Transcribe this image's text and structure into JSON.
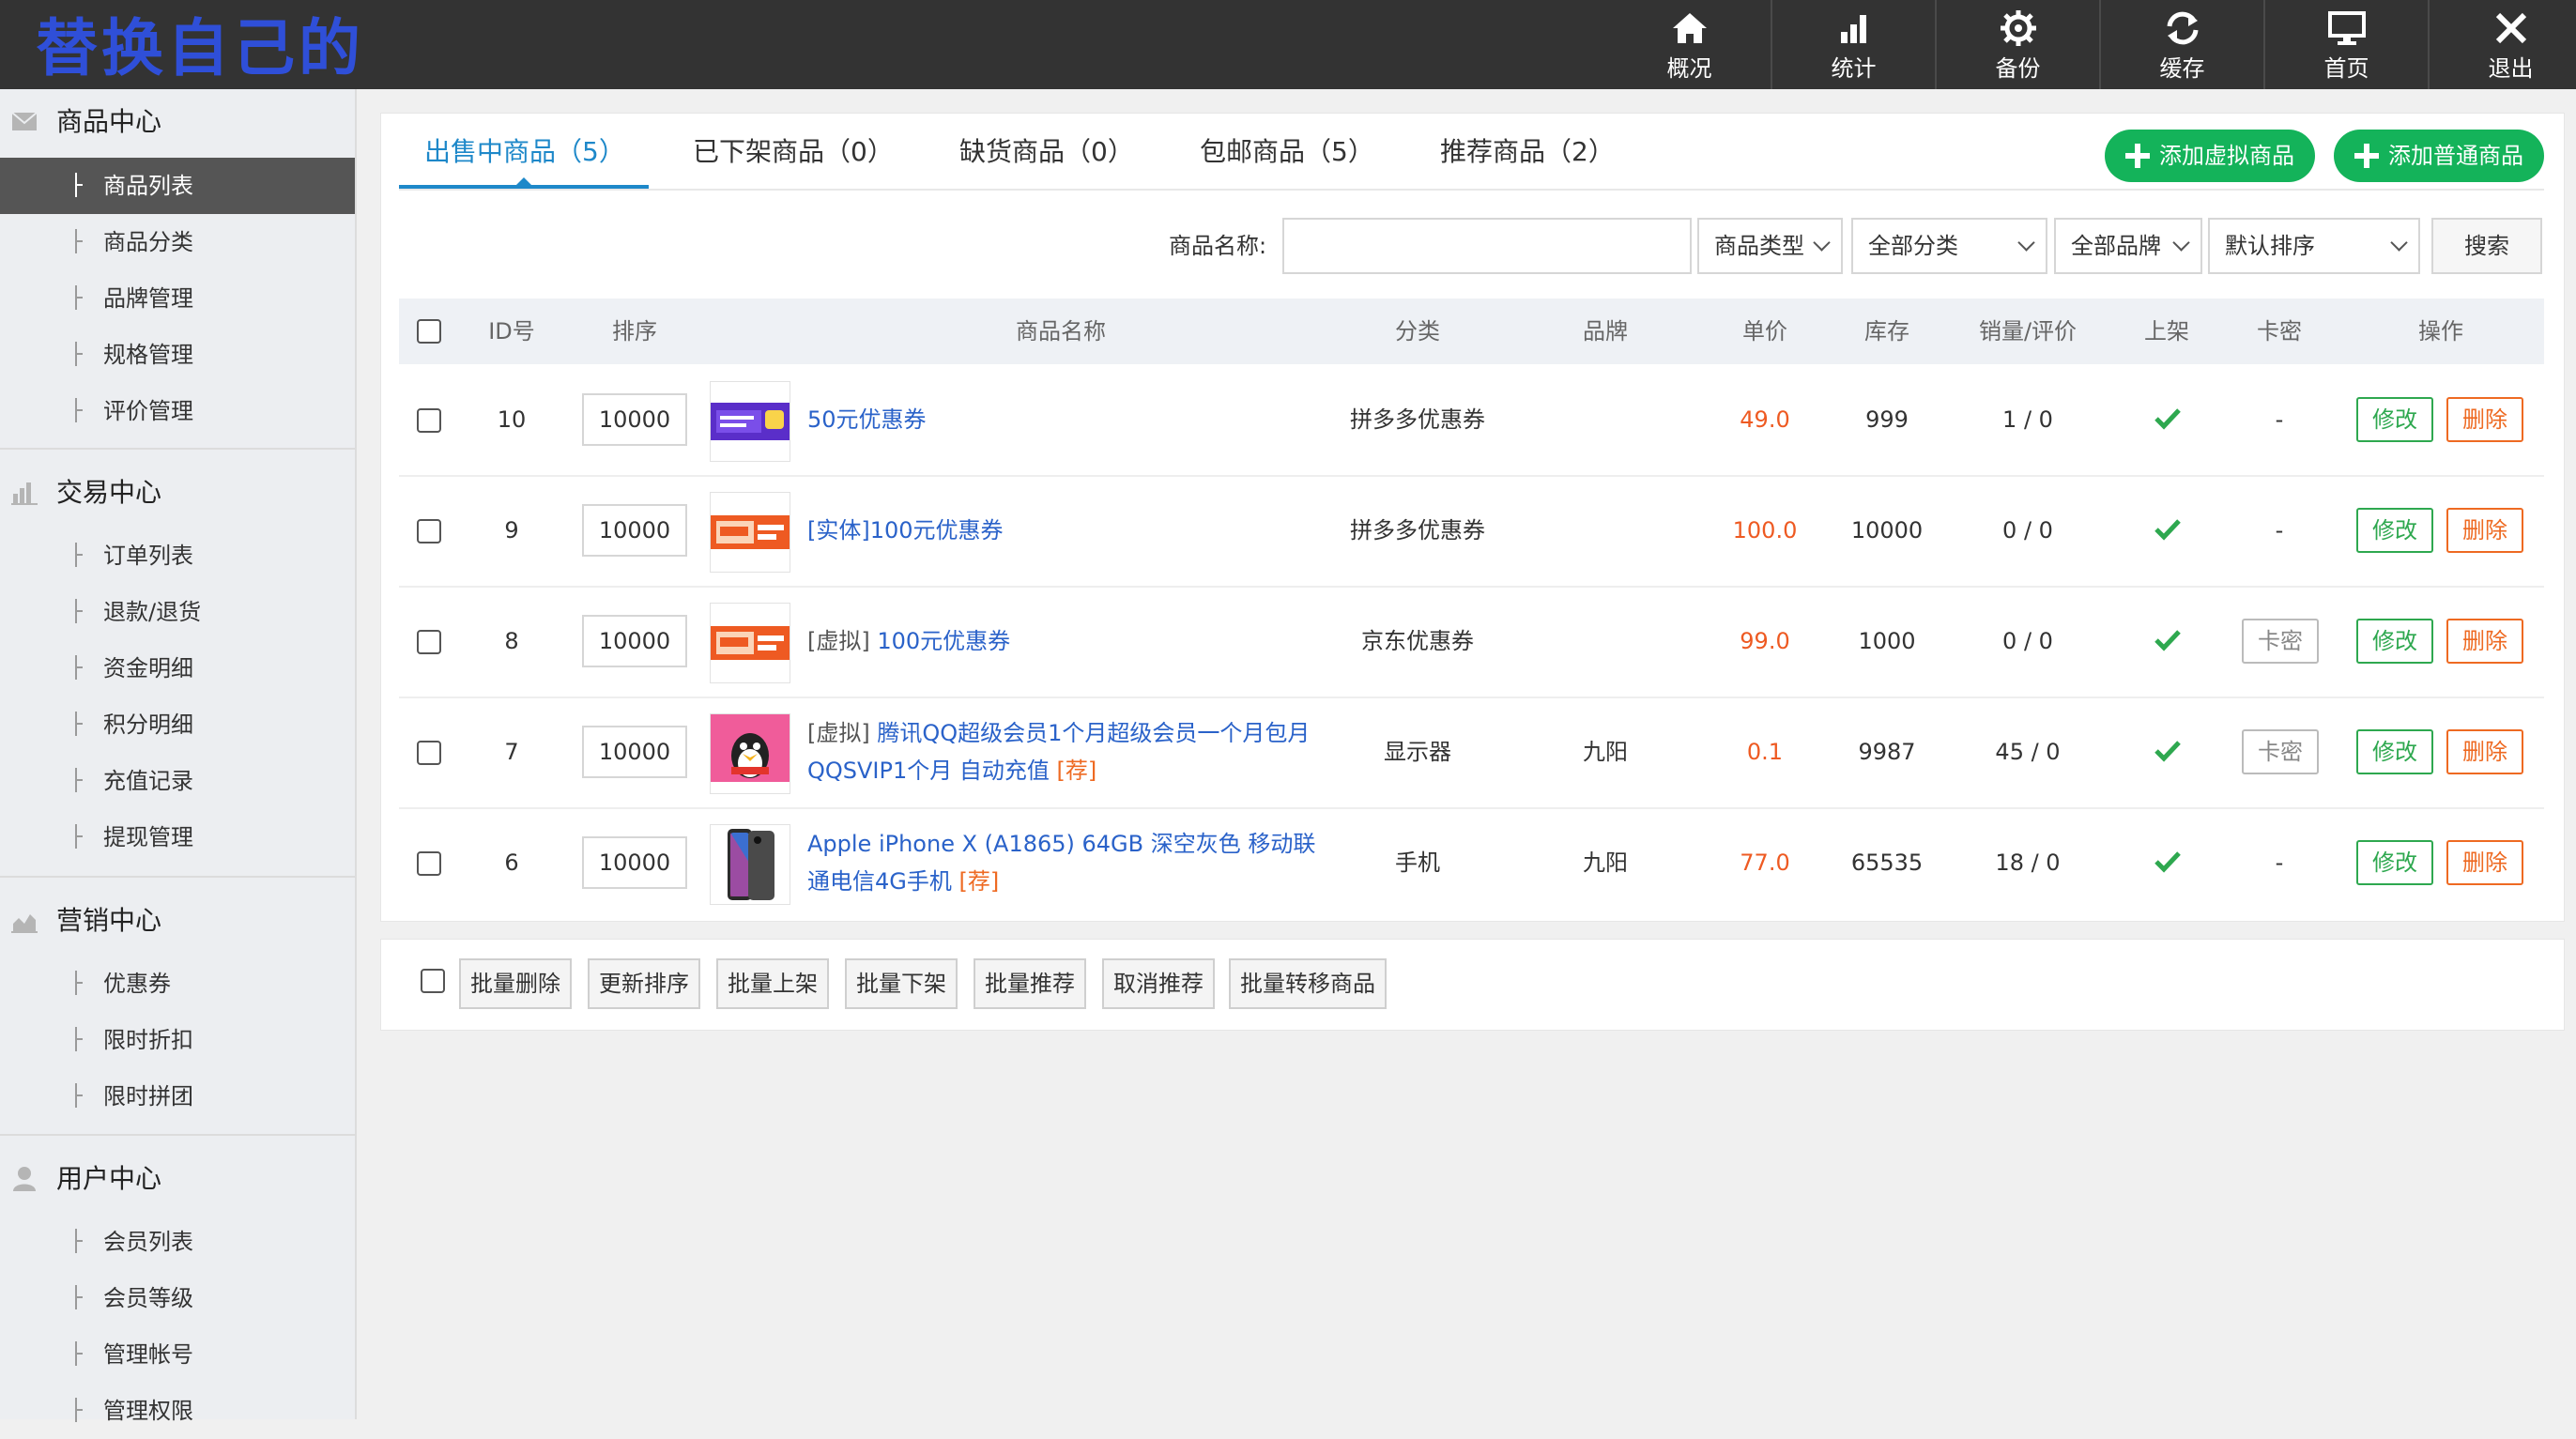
{
  "brand": "替换自己的",
  "topnav": [
    {
      "label": "概况",
      "icon": "home-icon"
    },
    {
      "label": "统计",
      "icon": "bar-chart-icon"
    },
    {
      "label": "备份",
      "icon": "gear-icon"
    },
    {
      "label": "缓存",
      "icon": "refresh-icon"
    },
    {
      "label": "首页",
      "icon": "monitor-icon"
    },
    {
      "label": "退出",
      "icon": "close-icon"
    }
  ],
  "sidebar": {
    "sections": [
      {
        "title": "商品中心",
        "icon": "mail-icon",
        "items": [
          "商品列表",
          "商品分类",
          "品牌管理",
          "规格管理",
          "评价管理"
        ]
      },
      {
        "title": "交易中心",
        "icon": "bar-chart-icon",
        "items": [
          "订单列表",
          "退款/退货",
          "资金明细",
          "积分明细",
          "充值记录",
          "提现管理"
        ]
      },
      {
        "title": "营销中心",
        "icon": "area-chart-icon",
        "items": [
          "优惠券",
          "限时折扣",
          "限时拼团"
        ]
      },
      {
        "title": "用户中心",
        "icon": "user-icon",
        "items": [
          "会员列表",
          "会员等级",
          "管理帐号",
          "管理权限"
        ]
      }
    ],
    "active_item": "商品列表"
  },
  "tabs": [
    {
      "label": "出售中商品（5）",
      "active": true
    },
    {
      "label": "已下架商品（0）",
      "active": false
    },
    {
      "label": "缺货商品（0）",
      "active": false
    },
    {
      "label": "包邮商品（5）",
      "active": false
    },
    {
      "label": "推荐商品（2）",
      "active": false
    }
  ],
  "actions": {
    "add_virtual": "添加虚拟商品",
    "add_normal": "添加普通商品"
  },
  "filters": {
    "name_label": "商品名称:",
    "name_value": "",
    "type": "商品类型",
    "category": "全部分类",
    "brand": "全部品牌",
    "sort": "默认排序",
    "search": "搜索"
  },
  "table": {
    "headers": [
      "ID号",
      "排序",
      "商品名称",
      "分类",
      "品牌",
      "单价",
      "库存",
      "销量/评价",
      "上架",
      "卡密",
      "操作"
    ],
    "rows": [
      {
        "id": "10",
        "sort": "10000",
        "tag": "",
        "name": "50元优惠券",
        "rec": "",
        "category": "拼多多优惠券",
        "brand": "",
        "price": "49.0",
        "stock": "999",
        "sales": "1 / 0",
        "on_shelf": true,
        "card": "-",
        "thumb": "coupon-purple"
      },
      {
        "id": "9",
        "sort": "10000",
        "tag": "",
        "name": "[实体]100元优惠券",
        "rec": "",
        "category": "拼多多优惠券",
        "brand": "",
        "price": "100.0",
        "stock": "10000",
        "sales": "0 / 0",
        "on_shelf": true,
        "card": "-",
        "thumb": "coupon-orange"
      },
      {
        "id": "8",
        "sort": "10000",
        "tag": "[虚拟]",
        "name": "100元优惠券",
        "rec": "",
        "category": "京东优惠券",
        "brand": "",
        "price": "99.0",
        "stock": "1000",
        "sales": "0 / 0",
        "on_shelf": true,
        "card": "卡密",
        "thumb": "coupon-orange"
      },
      {
        "id": "7",
        "sort": "10000",
        "tag": "[虚拟]",
        "name": "腾讯QQ超级会员1个月超级会员一个月包月QQSVIP1个月 自动充值",
        "rec": "[荐]",
        "category": "显示器",
        "brand": "九阳",
        "price": "0.1",
        "stock": "9987",
        "sales": "45 / 0",
        "on_shelf": true,
        "card": "卡密",
        "thumb": "qq-pink"
      },
      {
        "id": "6",
        "sort": "10000",
        "tag": "",
        "name": "Apple iPhone X (A1865) 64GB 深空灰色 移动联通电信4G手机",
        "rec": "[荐]",
        "category": "手机",
        "brand": "九阳",
        "price": "77.0",
        "stock": "65535",
        "sales": "18 / 0",
        "on_shelf": true,
        "card": "-",
        "thumb": "iphone"
      }
    ],
    "edit_label": "修改",
    "delete_label": "删除"
  },
  "batch": [
    "批量删除",
    "更新排序",
    "批量上架",
    "批量下架",
    "批量推荐",
    "取消推荐",
    "批量转移商品"
  ],
  "colors": {
    "accent": "#1e88c9",
    "green": "#14b35a",
    "orange": "#ee6a22",
    "topbar": "#333333"
  }
}
